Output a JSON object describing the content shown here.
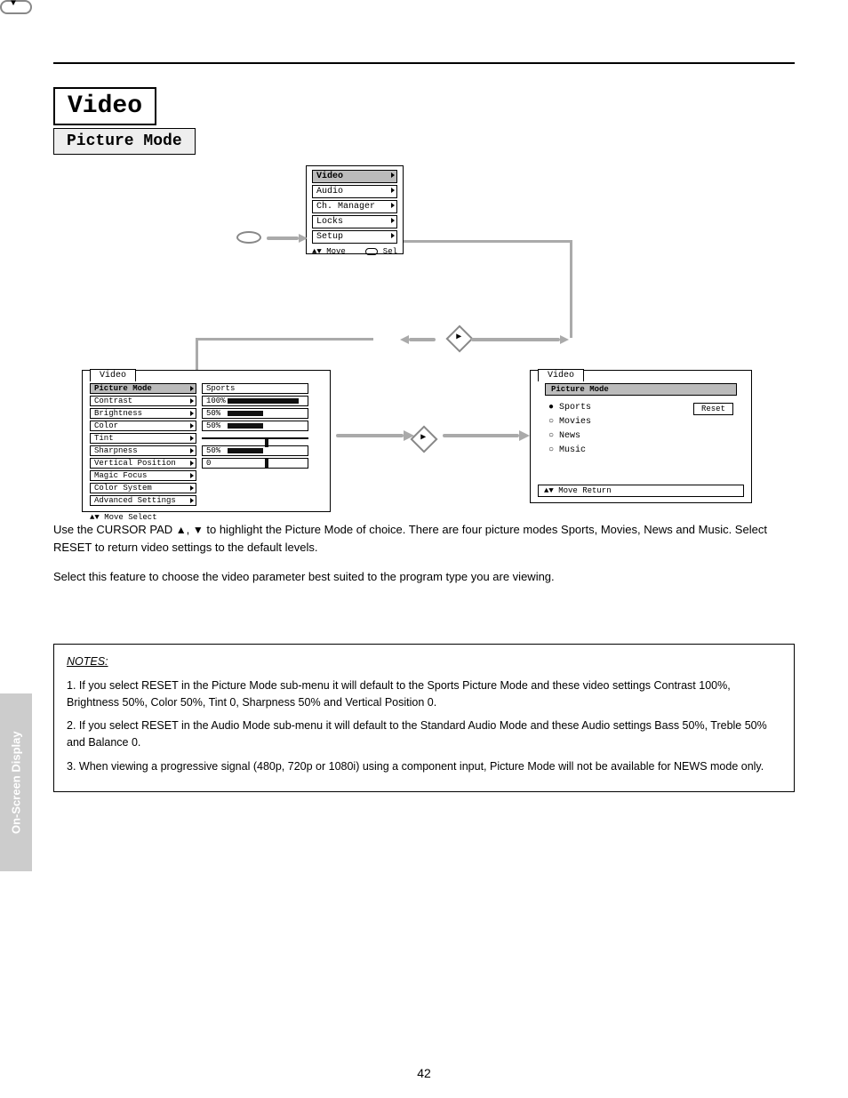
{
  "page_number": "42",
  "side_tab": "On-Screen Display",
  "title": "Video",
  "subtitle": "Picture Mode",
  "top_menu": {
    "items": [
      "Video",
      "Audio",
      "Ch. Manager",
      "Locks",
      "Setup"
    ],
    "highlight_index": 0,
    "footer_left": "Move",
    "footer_right": "Sel"
  },
  "left_menu": {
    "tab": "Video",
    "rows": [
      {
        "label": "Picture Mode",
        "value": "Sports",
        "bar": null,
        "hi": true
      },
      {
        "label": "Contrast",
        "value": "100%",
        "bar": 100
      },
      {
        "label": "Brightness",
        "value": "50%",
        "bar": 50
      },
      {
        "label": "Color",
        "value": "50%",
        "bar": 50
      },
      {
        "label": "Tint",
        "value": "",
        "bar": null,
        "tick": 60
      },
      {
        "label": "Sharpness",
        "value": "50%",
        "bar": 50
      },
      {
        "label": "Vertical Position",
        "value": "0",
        "bar": null,
        "tick": 60
      },
      {
        "label": "Magic Focus",
        "value": null
      },
      {
        "label": "Color System",
        "value": null
      },
      {
        "label": "Advanced Settings",
        "value": null
      }
    ],
    "footer": "Move      Select"
  },
  "right_menu": {
    "tab": "Video",
    "sub": "Picture Mode",
    "options": [
      "Sports",
      "Movies",
      "News",
      "Music"
    ],
    "selected_index": 0,
    "reset": "Reset",
    "footer": "Move      Return"
  },
  "body": {
    "p1_a": "Use the CURSOR PAD ",
    "p1_b": " to highlight the Picture Mode of choice. There are four picture modes Sports, Movies, News and Music. Select RESET to return video settings to the default levels.",
    "p2": "Select this feature to choose the video parameter best suited to the program type you are viewing."
  },
  "notes": {
    "title": "NOTES:",
    "n1": "1.  If you select RESET in the Picture Mode sub-menu it will default to the Sports Picture Mode and these video settings Contrast 100%, Brightness 50%, Color 50%, Tint 0, Sharpness 50% and Vertical Position 0.",
    "n2": "2.  If you select RESET in the Audio Mode sub-menu it will default to the Standard Audio Mode and these Audio settings Bass 50%, Treble 50% and Balance 0.",
    "n3": "3.  When viewing a progressive signal (480p, 720p or 1080i) using a component input, Picture Mode will not be available for NEWS mode only."
  }
}
